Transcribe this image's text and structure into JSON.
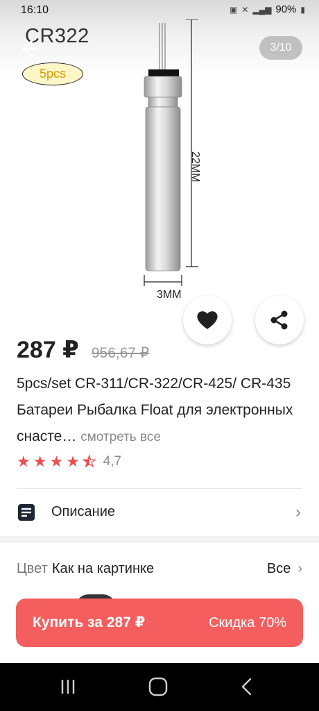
{
  "status_bar": {
    "time": "16:10",
    "battery": "90%"
  },
  "gallery": {
    "product_label": "CR322",
    "pack_badge": "5pcs",
    "page_counter": "3/10",
    "dimension_length": "22MM",
    "dimension_width": "3MM"
  },
  "product": {
    "price_current": "287 ₽",
    "price_old": "956,67 ₽",
    "title": "5pcs/set CR-311/CR-322/CR-425/ CR-435 Батареи Рыбалка Float для электронных снасте…",
    "see_all": "смотреть все",
    "rating_value": "4,7",
    "rating_stars": 4.7
  },
  "description": {
    "label": "Описание"
  },
  "color_option": {
    "label": "Цвет",
    "value": "Как на картинке",
    "all_label": "Все"
  },
  "buy": {
    "label": "Купить за 287 ₽",
    "discount": "Скидка 70%"
  },
  "colors": {
    "accent": "#f45e5e",
    "star": "#f04e4e",
    "badge_text": "#d79a00"
  }
}
